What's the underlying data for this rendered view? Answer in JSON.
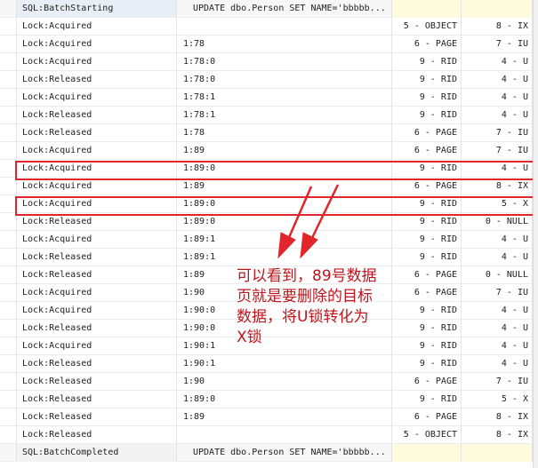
{
  "rows": [
    {
      "event": "SQL:BatchStarting",
      "resource": "UPDATE dbo.Person SET NAME='bbbbb...",
      "type": "",
      "mode": "",
      "kind": "cmd"
    },
    {
      "event": "Lock:Acquired",
      "resource": "",
      "type": "5 - OBJECT",
      "mode": "8 - IX"
    },
    {
      "event": "Lock:Acquired",
      "resource": "1:78",
      "type": "6 - PAGE",
      "mode": "7 - IU"
    },
    {
      "event": "Lock:Acquired",
      "resource": "1:78:0",
      "type": "9 - RID",
      "mode": "4 - U"
    },
    {
      "event": "Lock:Released",
      "resource": "1:78:0",
      "type": "9 - RID",
      "mode": "4 - U"
    },
    {
      "event": "Lock:Acquired",
      "resource": "1:78:1",
      "type": "9 - RID",
      "mode": "4 - U"
    },
    {
      "event": "Lock:Released",
      "resource": "1:78:1",
      "type": "9 - RID",
      "mode": "4 - U"
    },
    {
      "event": "Lock:Released",
      "resource": "1:78",
      "type": "6 - PAGE",
      "mode": "7 - IU"
    },
    {
      "event": "Lock:Acquired",
      "resource": "1:89",
      "type": "6 - PAGE",
      "mode": "7 - IU"
    },
    {
      "event": "Lock:Acquired",
      "resource": "1:89:0",
      "type": "9 - RID",
      "mode": "4 - U"
    },
    {
      "event": "Lock:Acquired",
      "resource": "1:89",
      "type": "6 - PAGE",
      "mode": "8 - IX"
    },
    {
      "event": "Lock:Acquired",
      "resource": "1:89:0",
      "type": "9 - RID",
      "mode": "5 - X"
    },
    {
      "event": "Lock:Released",
      "resource": "1:89:0",
      "type": "9 - RID",
      "mode": "0 - NULL"
    },
    {
      "event": "Lock:Acquired",
      "resource": "1:89:1",
      "type": "9 - RID",
      "mode": "4 - U"
    },
    {
      "event": "Lock:Released",
      "resource": "1:89:1",
      "type": "9 - RID",
      "mode": "4 - U"
    },
    {
      "event": "Lock:Released",
      "resource": "1:89",
      "type": "6 - PAGE",
      "mode": "0 - NULL"
    },
    {
      "event": "Lock:Acquired",
      "resource": "1:90",
      "type": "6 - PAGE",
      "mode": "7 - IU"
    },
    {
      "event": "Lock:Acquired",
      "resource": "1:90:0",
      "type": "9 - RID",
      "mode": "4 - U"
    },
    {
      "event": "Lock:Released",
      "resource": "1:90:0",
      "type": "9 - RID",
      "mode": "4 - U"
    },
    {
      "event": "Lock:Acquired",
      "resource": "1:90:1",
      "type": "9 - RID",
      "mode": "4 - U"
    },
    {
      "event": "Lock:Released",
      "resource": "1:90:1",
      "type": "9 - RID",
      "mode": "4 - U"
    },
    {
      "event": "Lock:Released",
      "resource": "1:90",
      "type": "6 - PAGE",
      "mode": "7 - IU"
    },
    {
      "event": "Lock:Released",
      "resource": "1:89:0",
      "type": "9 - RID",
      "mode": "5 - X"
    },
    {
      "event": "Lock:Released",
      "resource": "1:89",
      "type": "6 - PAGE",
      "mode": "8 - IX"
    },
    {
      "event": "Lock:Released",
      "resource": "",
      "type": "5 - OBJECT",
      "mode": "8 - IX"
    },
    {
      "event": "SQL:BatchCompleted",
      "resource": "UPDATE dbo.Person SET NAME='bbbbb...",
      "type": "",
      "mode": "",
      "kind": "cmd"
    }
  ],
  "highlighted_rows": [
    9,
    11
  ],
  "annotation": {
    "lines": [
      "可以看到，89号数据",
      "页就是要删除的目标",
      "数据，将U锁转化为",
      "X锁"
    ],
    "color": "#c0141c"
  },
  "colors": {
    "highlight_border": "#e0262a",
    "arrow": "#e0262a"
  }
}
